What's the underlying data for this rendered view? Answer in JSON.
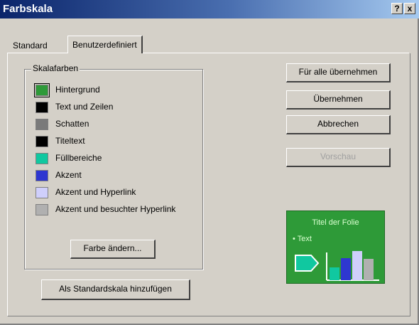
{
  "window": {
    "title": "Farbskala",
    "help_button": "?",
    "close_button": "x"
  },
  "tabs": [
    {
      "label": "Standard",
      "active": false
    },
    {
      "label": "Benutzerdefiniert",
      "active": true
    }
  ],
  "scheme_group": {
    "title": "Skalafarben",
    "colors": [
      {
        "label": "Hintergrund",
        "color": "#2e9a38",
        "selected": true
      },
      {
        "label": "Text und Zeilen",
        "color": "#000000"
      },
      {
        "label": "Schatten",
        "color": "#7a7a7a"
      },
      {
        "label": "Titeltext",
        "color": "#000000"
      },
      {
        "label": "Füllbereiche",
        "color": "#10c8a0"
      },
      {
        "label": "Akzent",
        "color": "#2e37d0"
      },
      {
        "label": "Akzent und Hyperlink",
        "color": "#cfcffb"
      },
      {
        "label": "Akzent und besuchter Hyperlink",
        "color": "#b0b0b0"
      }
    ],
    "change_color_button": "Farbe ändern..."
  },
  "add_standard_button": "Als Standardskala hinzufügen",
  "buttons": {
    "apply_all": "Für alle übernehmen",
    "apply": "Übernehmen",
    "cancel": "Abbrechen",
    "preview": "Vorschau"
  },
  "preview_slide": {
    "title": "Titel der Folie",
    "bullet": "• Text",
    "background_color": "#2e9a38"
  }
}
